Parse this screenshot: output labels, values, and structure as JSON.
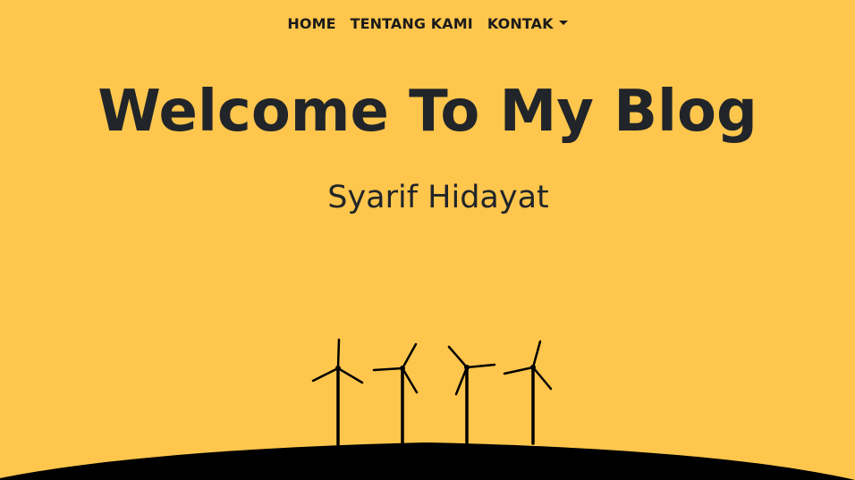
{
  "nav": {
    "items": [
      {
        "label": "HOME"
      },
      {
        "label": "TENTANG KAMI"
      },
      {
        "label": "KONTAK"
      }
    ]
  },
  "hero": {
    "title": "Welcome To My Blog",
    "subtitle": "Syarif Hidayat"
  },
  "colors": {
    "background": "#FFC64D",
    "text": "#212529",
    "silhouette": "#000000"
  },
  "icons": {
    "dropdown": "caret-down-icon",
    "illustration": "wind-turbines-illustration"
  }
}
